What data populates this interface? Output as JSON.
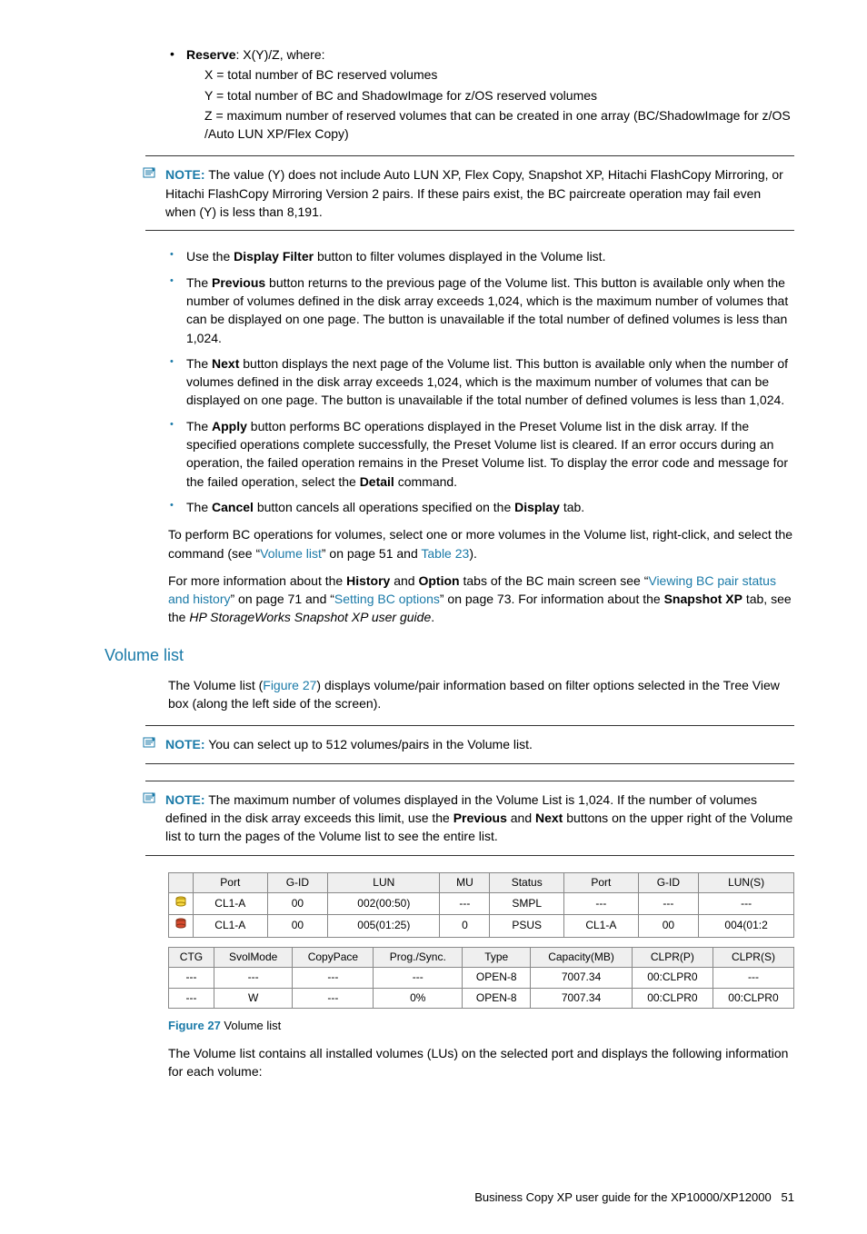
{
  "reserve": {
    "heading": "Reserve",
    "suffix": ": X(Y)/Z, where:",
    "lines": [
      "X = total number of BC reserved volumes",
      "Y = total number of BC and ShadowImage for z/OS reserved volumes",
      "Z = maximum number of reserved volumes that can be created in one array (BC/ShadowImage for z/OS /Auto LUN XP/Flex Copy)"
    ]
  },
  "note1": {
    "label": "NOTE:",
    "text": " The value (Y) does not include Auto LUN XP, Flex Copy, Snapshot XP, Hitachi FlashCopy Mirroring, or Hitachi FlashCopy Mirroring Version 2 pairs. If these pairs exist, the BC paircreate operation may fail even when (Y) is less than 8,191."
  },
  "bullets": {
    "b1a": "Use the ",
    "b1b": "Display Filter",
    "b1c": " button to filter volumes displayed in the Volume list.",
    "b2a": "The ",
    "b2b": "Previous",
    "b2c": " button returns to the previous page of the Volume list. This button is available only when the number of volumes defined in the disk array exceeds 1,024, which is the maximum number of volumes that can be displayed on one page. The button is unavailable if the total number of defined volumes is less than 1,024.",
    "b3a": "The ",
    "b3b": "Next",
    "b3c": " button displays the next page of the Volume list. This button is available only when the number of volumes defined in the disk array exceeds 1,024, which is the maximum number of volumes that can be displayed on one page. The button is unavailable if the total number of defined volumes is less than 1,024.",
    "b4a": "The ",
    "b4b": "Apply",
    "b4c": " button performs BC operations displayed in the Preset Volume list in the disk array. If the specified operations complete successfully, the Preset Volume list is cleared. If an error occurs during an operation, the failed operation remains in the Preset Volume list. To display the error code and message for the failed operation, select the ",
    "b4d": "Detail",
    "b4e": " command.",
    "b5a": "The ",
    "b5b": "Cancel",
    "b5c": " button cancels all operations specified on the ",
    "b5d": "Display",
    "b5e": " tab."
  },
  "para1": {
    "p1": "To perform BC operations for volumes, select one or more volumes in the Volume list, right-click, and select the command (see “",
    "link1": "Volume list",
    "p2": "” on page 51 and ",
    "link2": "Table 23",
    "p3": ")."
  },
  "para2": {
    "p1": "For more information about the ",
    "b1": "History",
    "p2": " and ",
    "b2": "Option",
    "p3": " tabs of the BC main screen see “",
    "link1": "Viewing BC pair status and history",
    "p4": "” on page 71 and “",
    "link2": "Setting BC options",
    "p5": "” on page 73. For information about the ",
    "b3": "Snapshot XP",
    "p6": " tab, see the ",
    "i1": "HP StorageWorks Snapshot XP user guide",
    "p7": "."
  },
  "volumeList": {
    "heading": "Volume list",
    "intro1": "The Volume list (",
    "introLink": "Figure 27",
    "intro2": ") displays volume/pair information based on filter options selected in the Tree View box (along the left side of the screen)."
  },
  "note2": {
    "label": "NOTE:",
    "text": " You can select up to 512 volumes/pairs in the Volume list."
  },
  "note3": {
    "label": "NOTE:",
    "text1": " The maximum number of volumes displayed in the Volume List is 1,024. If the number of volumes defined in the disk array exceeds this limit, use the ",
    "b1": "Previous",
    "text2": " and ",
    "b2": "Next",
    "text3": " buttons on the upper right of the Volume list to turn the pages of the Volume list to see the entire list."
  },
  "table1": {
    "headers": [
      "Port",
      "G-ID",
      "LUN",
      "MU",
      "Status",
      "Port",
      "G-ID",
      "LUN(S)"
    ],
    "rows": [
      {
        "icon": "vol-yellow",
        "cells": [
          "CL1-A",
          "00",
          "002(00:50)",
          "---",
          "SMPL",
          "---",
          "---",
          "---"
        ]
      },
      {
        "icon": "vol-red",
        "cells": [
          "CL1-A",
          "00",
          "005(01:25)",
          "0",
          "PSUS",
          "CL1-A",
          "00",
          "004(01:2"
        ]
      }
    ]
  },
  "table2": {
    "headers": [
      "CTG",
      "SvolMode",
      "CopyPace",
      "Prog./Sync.",
      "Type",
      "Capacity(MB)",
      "CLPR(P)",
      "CLPR(S)"
    ],
    "rows": [
      [
        "---",
        "---",
        "---",
        "---",
        "OPEN-8",
        "7007.34",
        "00:CLPR0",
        "---"
      ],
      [
        "---",
        "W",
        "---",
        "0%",
        "OPEN-8",
        "7007.34",
        "00:CLPR0",
        "00:CLPR0"
      ]
    ]
  },
  "figure": {
    "num": "Figure 27",
    "title": " Volume list"
  },
  "afterFigure": "The Volume list contains all installed volumes (LUs) on the selected port and displays the following information for each volume:",
  "footer": {
    "text": "Business Copy XP user guide for the XP10000/XP12000",
    "page": "51"
  }
}
